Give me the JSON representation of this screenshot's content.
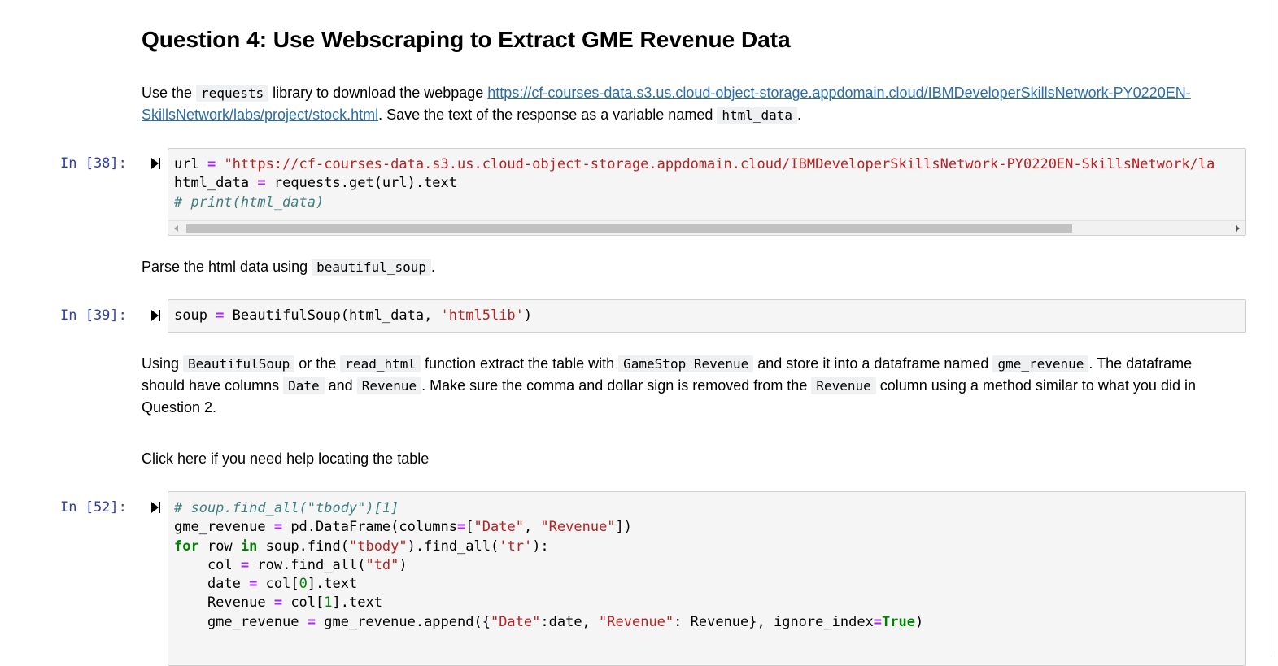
{
  "question": {
    "heading": "Question 4: Use Webscraping to Extract GME Revenue Data"
  },
  "instruction1": {
    "t1": "Use the ",
    "c1": "requests",
    "t2": " library to download the webpage ",
    "link": "https://cf-courses-data.s3.us.cloud-object-storage.appdomain.cloud/IBMDeveloperSkillsNetwork-PY0220EN-SkillsNetwork/labs/project/stock.html",
    "t3": ". Save the text of the response as a variable named ",
    "c2": "html_data",
    "t4": "."
  },
  "cell38": {
    "prompt": "In [38]:",
    "lines": [
      [
        "url",
        " = ",
        "\"https://cf-courses-data.s3.us.cloud-object-storage.appdomain.cloud/IBMDeveloperSkillsNetwork-PY0220EN-SkillsNetwork/la"
      ],
      [
        "html_data",
        " = ",
        "requests.get(url).text"
      ],
      [
        "# print(html_data)"
      ]
    ]
  },
  "instruction2": {
    "t1": "Parse the html data using ",
    "c1": "beautiful_soup",
    "t2": "."
  },
  "cell39": {
    "prompt": "In [39]:",
    "line": [
      "soup",
      " = ",
      "BeautifulSoup(html_data, ",
      "'html5lib'",
      ")"
    ]
  },
  "instruction3": {
    "t1": "Using ",
    "c1": "BeautifulSoup",
    "t2": " or the ",
    "c2": "read_html",
    "t3": " function extract the table with ",
    "c3": "GameStop Revenue",
    "t4": " and store it into a dataframe named ",
    "c4": "gme_revenue",
    "t5": ". The dataframe should have columns ",
    "c5": "Date",
    "t6": " and ",
    "c6": "Revenue",
    "t7": ". Make sure the comma and dollar sign is removed from the ",
    "c7": "Revenue",
    "t8": " column using a method similar to what you did in Question 2."
  },
  "help_text": "Click here if you need help locating the table",
  "cell52": {
    "prompt": "In [52]:",
    "l1": "# soup.find_all(\"tbody\")[1]",
    "l2": [
      "gme_revenue",
      " = ",
      "pd.DataFrame(columns",
      "=",
      "[",
      "\"Date\"",
      ", ",
      "\"Revenue\"",
      "])"
    ],
    "l3": [
      "for",
      " row ",
      "in",
      " soup.find(",
      "\"tbody\"",
      ").find_all(",
      "'tr'",
      "):"
    ],
    "l4": [
      "    col",
      " = ",
      "row.find_all(",
      "\"td\"",
      ")"
    ],
    "l5": [
      "    date",
      " = ",
      "col[",
      "0",
      "].text"
    ],
    "l6": [
      "    Revenue",
      " = ",
      "col[",
      "1",
      "].text"
    ],
    "l7": [
      "    gme_revenue",
      " = ",
      "gme_revenue.append({",
      "\"Date\"",
      ":date, ",
      "\"Revenue\"",
      ": Revenue}, ignore_index",
      "=",
      "True",
      ")"
    ]
  }
}
